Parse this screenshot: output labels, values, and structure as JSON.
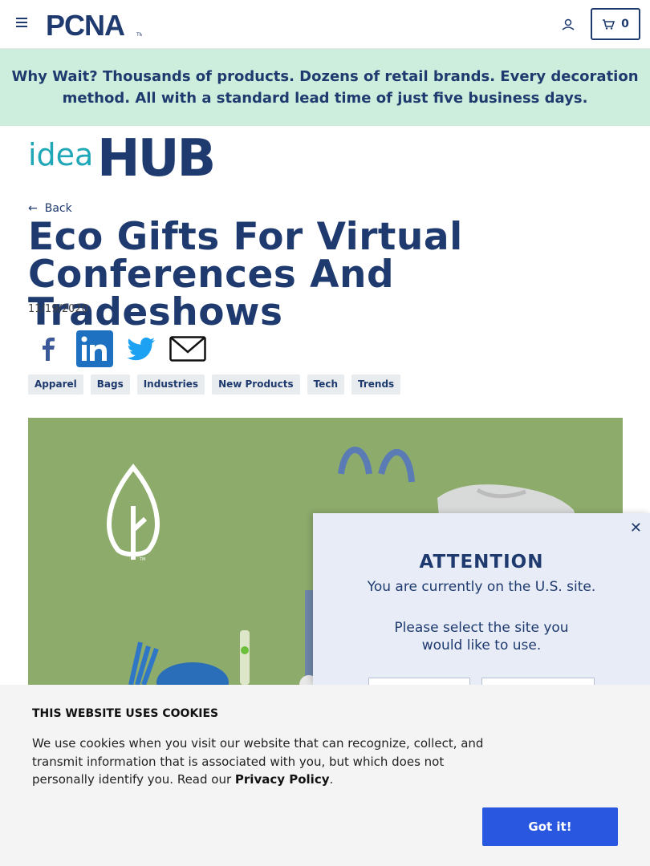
{
  "header": {
    "cart_count": "0"
  },
  "banner": {
    "lead": "Why Wait?",
    "text": " Thousands of products. Dozens of retail brands. Every decoration method. All with a standard lead time of just five business days."
  },
  "article": {
    "back_label": "Back",
    "title": "Eco Gifts For Virtual Conferences And Tradeshows",
    "date": "11/19/2020",
    "tags": [
      "Apparel",
      "Bags",
      "Industries",
      "New Products",
      "Tech",
      "Trends"
    ]
  },
  "modal": {
    "heading": "ATTENTION",
    "line1": "You are currently on the U.S. site.",
    "line2": "Please select the site you would like to use."
  },
  "cookies": {
    "heading": "THIS WEBSITE USES COOKIES",
    "body": "We use cookies when you visit our website that can recognize, collect, and transmit information that is associated with you, but which does not personally identify you. Read our ",
    "link": "Privacy Policy",
    "end": ".",
    "button": "Got it!"
  },
  "colors": {
    "brand_navy": "#1e3a6e",
    "banner_bg": "#cdeedd",
    "accent_teal": "#1fa7b8",
    "button_blue": "#2a57e0"
  }
}
